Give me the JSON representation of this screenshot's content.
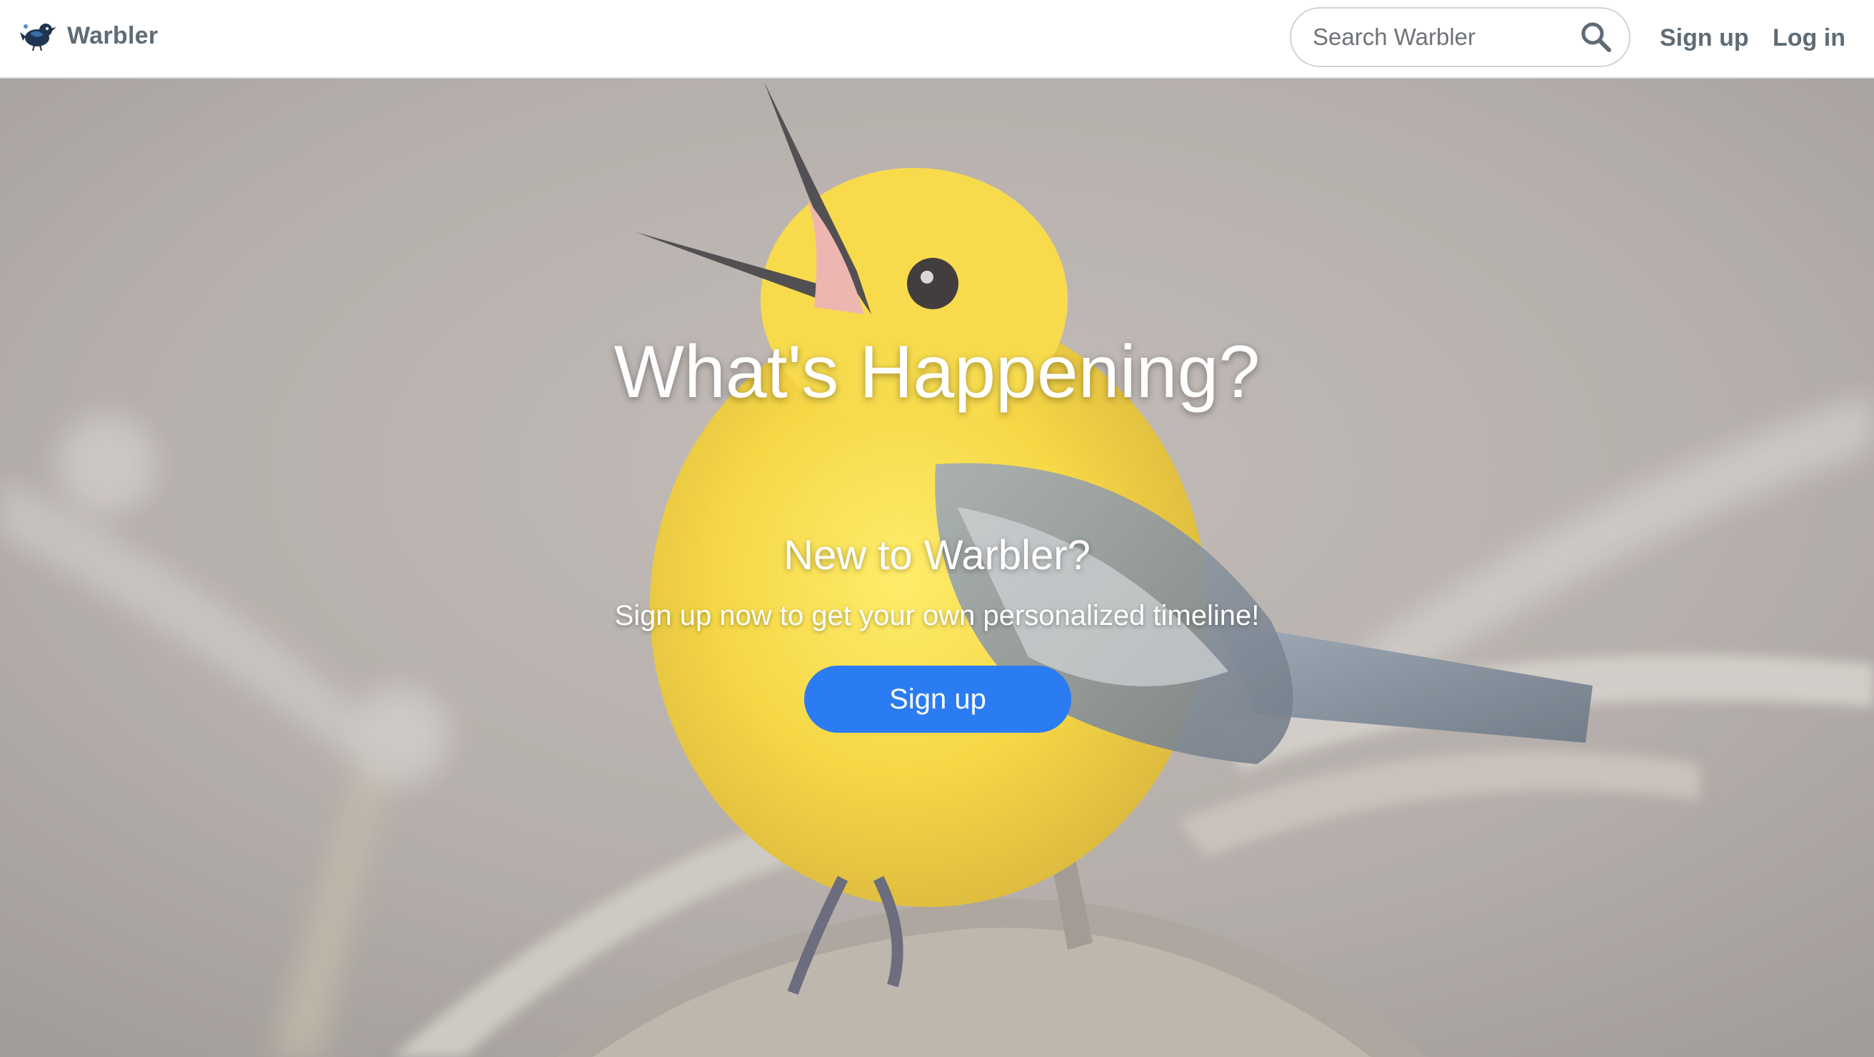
{
  "navbar": {
    "brand_name": "Warbler",
    "logo_icon": "warbler-bird-icon",
    "search_placeholder": "Search Warbler",
    "search_icon": "search-icon",
    "signup_label": "Sign up",
    "login_label": "Log in"
  },
  "hero": {
    "title": "What's Happening?",
    "subtitle": "New to Warbler?",
    "lead": "Sign up now to get your own personalized timeline!",
    "signup_button": "Sign up",
    "background": "warbler-photo"
  },
  "colors": {
    "brand_text": "#5f6b75",
    "primary_button": "#2b7cf2",
    "hero_text": "#ffffff"
  }
}
